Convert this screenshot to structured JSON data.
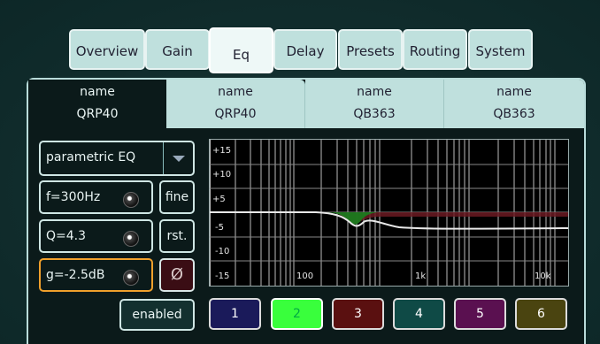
{
  "tabs": [
    {
      "label": "Overview",
      "active": false
    },
    {
      "label": "Gain",
      "active": false
    },
    {
      "label": "Eq",
      "active": true
    },
    {
      "label": "Delay",
      "active": false
    },
    {
      "label": "Presets",
      "active": false
    },
    {
      "label": "Routing",
      "active": false
    },
    {
      "label": "System",
      "active": false
    }
  ],
  "channels": [
    {
      "name_label": "name",
      "model": "QRP40",
      "active": true
    },
    {
      "name_label": "name",
      "model": "QRP40",
      "active": false
    },
    {
      "name_label": "name",
      "model": "QB363",
      "active": false
    },
    {
      "name_label": "name",
      "model": "QB363",
      "active": false
    }
  ],
  "eq": {
    "type": "parametric EQ",
    "frequency": "f=300Hz",
    "q": "Q=4.3",
    "gain": "g=-2.5dB",
    "fine_label": "fine",
    "reset_label": "rst.",
    "phase_label": "Ø",
    "enabled_label": "enabled"
  },
  "graph": {
    "y_labels": [
      "+15",
      "+10",
      "+5",
      "-5",
      "-10",
      "-15"
    ],
    "x_labels": [
      "100",
      "1k",
      "10k"
    ]
  },
  "bands": [
    {
      "label": "1",
      "color": "#1a1a5a",
      "active": false
    },
    {
      "label": "2",
      "color": "#39ff3c",
      "active": true
    },
    {
      "label": "3",
      "color": "#5a1010",
      "active": false
    },
    {
      "label": "4",
      "color": "#0f4a46",
      "active": false
    },
    {
      "label": "5",
      "color": "#5a1050",
      "active": false
    },
    {
      "label": "6",
      "color": "#4a4410",
      "active": false
    }
  ]
}
